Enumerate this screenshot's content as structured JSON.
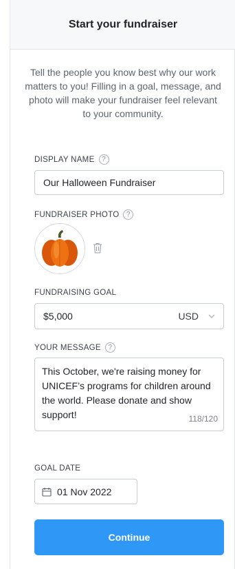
{
  "header": {
    "title": "Start your fundraiser"
  },
  "intro": {
    "text": "Tell the people you know best why our work matters to you! Filling in a goal, message, and photo will make your fundraiser feel relevant to your community."
  },
  "display_name": {
    "label": "DISPLAY NAME",
    "value": "Our Halloween Fundraiser"
  },
  "photo": {
    "label": "FUNDRAISER PHOTO",
    "image": "pumpkin"
  },
  "goal": {
    "label": "FUNDRAISING GOAL",
    "value": "$5,000",
    "currency": "USD"
  },
  "message": {
    "label": "YOUR MESSAGE",
    "value": "This October, we're raising money for UNICEF’s programs for children around the world. Please donate and show support!",
    "counter": "118/120"
  },
  "goal_date": {
    "label": "GOAL DATE",
    "value": "01 Nov 2022"
  },
  "help_glyph": "?",
  "actions": {
    "continue_label": "Continue"
  },
  "colors": {
    "primary": "#2f98f7",
    "border": "#c8cdd3",
    "header_bg": "#f7f8fa"
  }
}
